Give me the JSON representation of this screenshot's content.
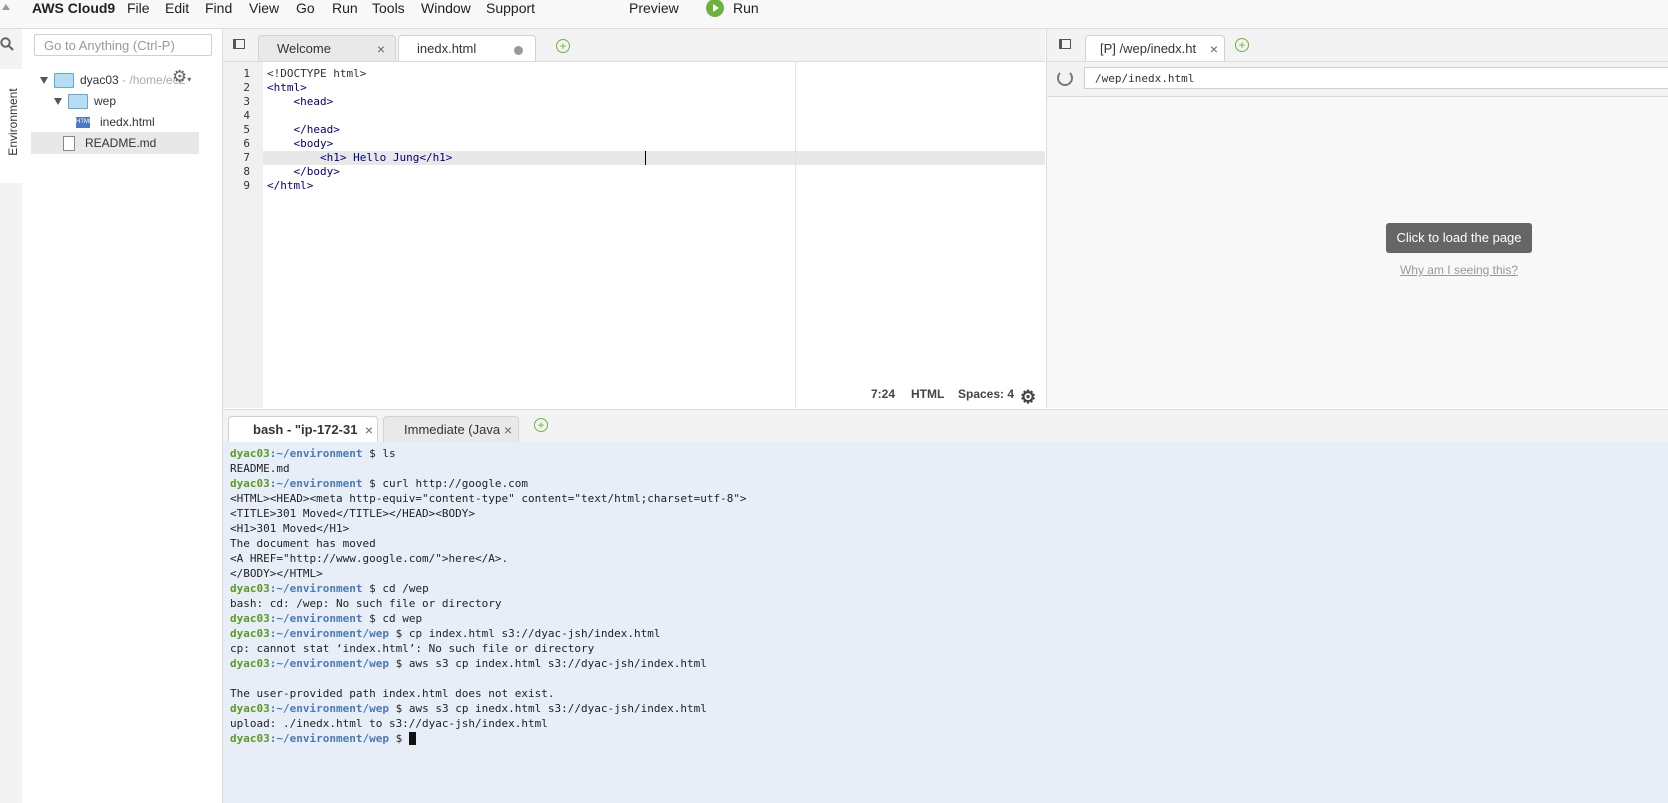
{
  "menubar": {
    "brand": "AWS Cloud9",
    "items": [
      "File",
      "Edit",
      "Find",
      "View",
      "Go",
      "Run",
      "Tools",
      "Window",
      "Support"
    ],
    "preview": "Preview",
    "run": "Run"
  },
  "sidebar": {
    "environment_tab": "Environment",
    "search_placeholder": "Go to Anything (Ctrl-P)",
    "tree": {
      "root_name": "dyac03",
      "root_path": " - /home/ec2",
      "folder": "wep",
      "file_html": "inedx.html",
      "file_readme": "README.md"
    }
  },
  "editor": {
    "tabs": [
      {
        "label": "Welcome",
        "active": false
      },
      {
        "label": "inedx.html",
        "active": true,
        "unsaved": true
      }
    ],
    "line_numbers": [
      "1",
      "2",
      "3",
      "4",
      "5",
      "6",
      "7",
      "8",
      "9"
    ],
    "lines": [
      "<!DOCTYPE html>",
      "<html>",
      "    <head>",
      "",
      "    </head>",
      "    <body>",
      "        <h1> Hello Jung</h1>",
      "    </body>",
      "</html>"
    ],
    "status": {
      "position": "7:24",
      "mode": "HTML",
      "indent": "Spaces: 4"
    }
  },
  "preview": {
    "tab_label": "[P] /wep/inedx.ht",
    "url": "/wep/inedx.html",
    "load_button": "Click to load the page",
    "why_link": "Why am I seeing this?"
  },
  "terminal": {
    "tabs": [
      {
        "label": "bash - \"ip-172-31",
        "active": true
      },
      {
        "label": "Immediate (Java",
        "active": false
      }
    ],
    "lines": [
      {
        "user": "dyac03",
        "path": ":~/environment",
        "cmd": " $ ls"
      },
      {
        "text": "README.md"
      },
      {
        "user": "dyac03",
        "path": ":~/environment",
        "cmd": " $ curl http://google.com"
      },
      {
        "text": "<HTML><HEAD><meta http-equiv=\"content-type\" content=\"text/html;charset=utf-8\">"
      },
      {
        "text": "<TITLE>301 Moved</TITLE></HEAD><BODY>"
      },
      {
        "text": "<H1>301 Moved</H1>"
      },
      {
        "text": "The document has moved"
      },
      {
        "text": "<A HREF=\"http://www.google.com/\">here</A>."
      },
      {
        "text": "</BODY></HTML>"
      },
      {
        "user": "dyac03",
        "path": ":~/environment",
        "cmd": " $ cd /wep"
      },
      {
        "text": "bash: cd: /wep: No such file or directory"
      },
      {
        "user": "dyac03",
        "path": ":~/environment",
        "cmd": " $ cd wep"
      },
      {
        "user": "dyac03",
        "path": ":~/environment/wep",
        "cmd": " $ cp index.html s3://dyac-jsh/index.html"
      },
      {
        "text": "cp: cannot stat ‘index.html’: No such file or directory"
      },
      {
        "user": "dyac03",
        "path": ":~/environment/wep",
        "cmd": " $ aws s3 cp index.html s3://dyac-jsh/index.html"
      },
      {
        "text": ""
      },
      {
        "text": "The user-provided path index.html does not exist."
      },
      {
        "user": "dyac03",
        "path": ":~/environment/wep",
        "cmd": " $ aws s3 cp inedx.html s3://dyac-jsh/index.html"
      },
      {
        "text": "upload: ./inedx.html to s3://dyac-jsh/index.html"
      },
      {
        "user": "dyac03",
        "path": ":~/environment/wep",
        "cmd": " $ "
      }
    ]
  },
  "colors": {
    "accent_green": "#6cb33e",
    "prompt_user": "#5b9a1f",
    "prompt_path": "#4a7ab8",
    "terminal_bg": "#e8eef7"
  }
}
